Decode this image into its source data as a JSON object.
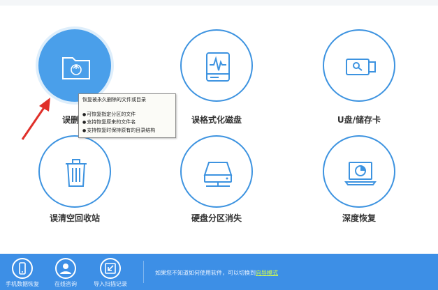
{
  "colors": {
    "accent": "#3d93e0",
    "active_fill": "#4a9fea",
    "footer_bg": "#3d8fe6",
    "link": "#d8ff4a",
    "arrow": "#e0302a"
  },
  "tiles": [
    {
      "label": "误删除",
      "icon": "folder-recycle-icon",
      "active": true
    },
    {
      "label": "误格式化磁盘",
      "icon": "drive-pulse-icon"
    },
    {
      "label": "U盘/储存卡",
      "icon": "usb-drive-icon"
    },
    {
      "label": "误清空回收站",
      "icon": "trash-bin-icon"
    },
    {
      "label": "硬盘分区消失",
      "icon": "hard-disk-network-icon"
    },
    {
      "label": "深度恢复",
      "icon": "laptop-gauge-icon"
    }
  ],
  "tooltip": {
    "title": "恢复被永久删除的文件或目录",
    "items": [
      "可恢复指定分区的文件",
      "支持恢复原来的文件名",
      "支持恢复时保持原有的目录结构"
    ]
  },
  "footer": {
    "buttons": [
      {
        "label": "手机数据恢复",
        "icon": "phone-icon"
      },
      {
        "label": "在线咨询",
        "icon": "user-support-icon"
      },
      {
        "label": "导入扫描记录",
        "icon": "import-icon"
      }
    ],
    "hint_text": "如果您不知道如何使用软件，可以切换到",
    "hint_link": "向导模式"
  }
}
